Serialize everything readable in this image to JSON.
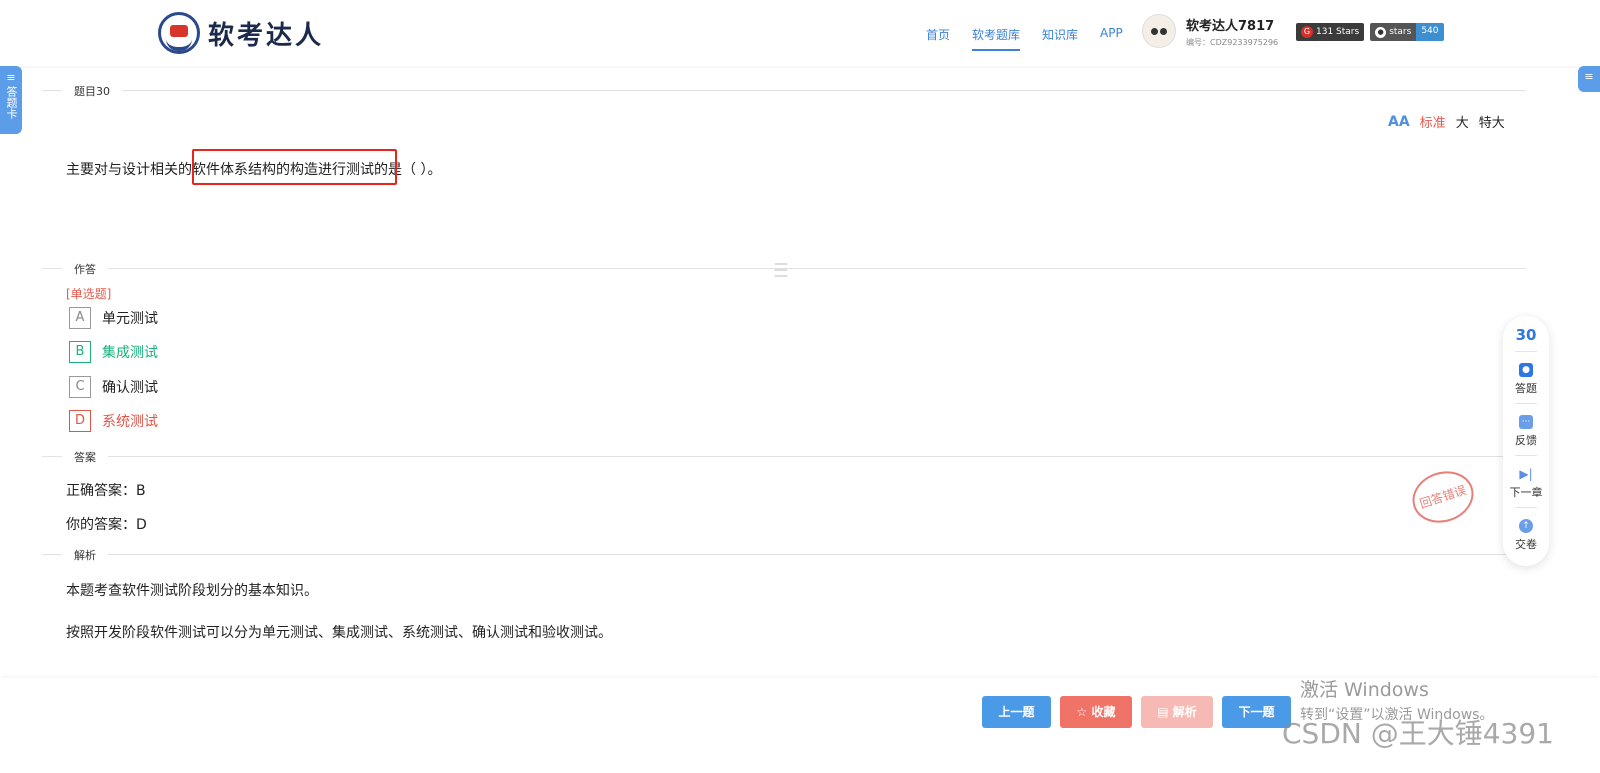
{
  "header": {
    "logo_text": "软考达人",
    "nav": [
      {
        "label": "首页"
      },
      {
        "label": "软考题库"
      },
      {
        "label": "知识库"
      },
      {
        "label": "APP"
      }
    ],
    "user": {
      "name": "软考达人7817",
      "id": "编号：CDZ9233975296"
    },
    "badges": [
      {
        "icon": "gitee-icon",
        "left": "131 Stars",
        "right": ""
      },
      {
        "icon": "github-icon",
        "left": "stars",
        "right": "540"
      }
    ]
  },
  "sidebar": {
    "answer_card_label": "答题卡"
  },
  "question": {
    "section_label": "题目30",
    "font_sizes": [
      "标准",
      "大",
      "特大"
    ],
    "text": "主要对与设计相关的软件体系结构的构造进行测试的是（ ）。"
  },
  "answer_area": {
    "section_label": "作答",
    "type": "[单选题]",
    "options": [
      {
        "key": "A",
        "text": "单元测试"
      },
      {
        "key": "B",
        "text": "集成测试"
      },
      {
        "key": "C",
        "text": "确认测试"
      },
      {
        "key": "D",
        "text": "系统测试"
      }
    ]
  },
  "answer": {
    "section_label": "答案",
    "correct": "正确答案：B",
    "yours": "你的答案：D",
    "stamp": "回答错误"
  },
  "analysis": {
    "section_label": "解析",
    "paragraphs": [
      "本题考查软件测试阶段划分的基本知识。",
      "按照开发阶段软件测试可以分为单元测试、集成测试、系统测试、确认测试和验收测试。"
    ]
  },
  "float_panel": {
    "number": "30",
    "items": [
      {
        "label": "答题"
      },
      {
        "label": "反馈"
      },
      {
        "label": "下一章"
      },
      {
        "label": "交卷"
      }
    ]
  },
  "bottom": {
    "prev": "上一题",
    "fav": "☆ 收藏",
    "analysis": "解析",
    "next": "下一题"
  },
  "watermark": {
    "line1": "激活 Windows",
    "line2": "转到“设置”以激活 Windows。",
    "csdn": "CSDN @王大锤4391"
  },
  "colors": {
    "accent": "#3b83d8",
    "correct": "#1ab27a",
    "wrong": "#e05548",
    "highlight": "#e8251c"
  }
}
